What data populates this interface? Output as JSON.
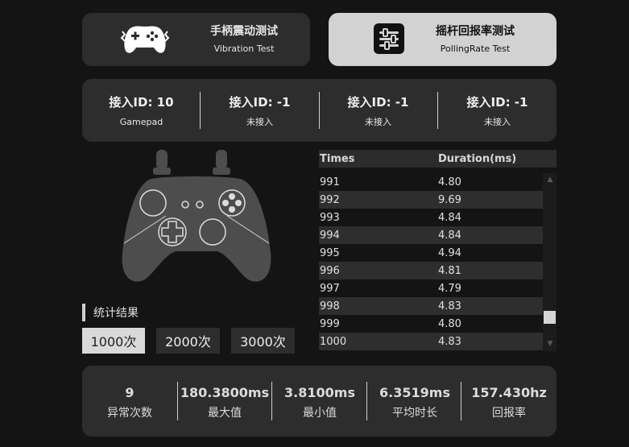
{
  "tabs": {
    "vibration": {
      "title": "手柄震动测试",
      "subtitle": "Vibration Test",
      "icon": "gamepad-vibration-icon"
    },
    "polling": {
      "title": "摇杆回报率测试",
      "subtitle": "PollingRate Test",
      "icon": "sliders-icon",
      "active": true
    }
  },
  "connections": [
    {
      "id": "接入ID: 10",
      "status": "Gamepad"
    },
    {
      "id": "接入ID: -1",
      "status": "未接入"
    },
    {
      "id": "接入ID: -1",
      "status": "未接入"
    },
    {
      "id": "接入ID: -1",
      "status": "未接入"
    }
  ],
  "stats": {
    "label": "统计结果",
    "buttons": [
      "1000次",
      "2000次",
      "3000次"
    ],
    "selected": "1000次"
  },
  "table": {
    "headers": [
      "Times",
      "Duration(ms)"
    ],
    "rows": [
      [
        "991",
        "4.80"
      ],
      [
        "992",
        "9.69"
      ],
      [
        "993",
        "4.84"
      ],
      [
        "994",
        "4.84"
      ],
      [
        "995",
        "4.94"
      ],
      [
        "996",
        "4.81"
      ],
      [
        "997",
        "4.79"
      ],
      [
        "998",
        "4.83"
      ],
      [
        "999",
        "4.80"
      ],
      [
        "1000",
        "4.83"
      ]
    ]
  },
  "summary": [
    {
      "value": "9",
      "label": "异常次数"
    },
    {
      "value": "180.3800ms",
      "label": "最大值"
    },
    {
      "value": "3.8100ms",
      "label": "最小值"
    },
    {
      "value": "6.3519ms",
      "label": "平均时长"
    },
    {
      "value": "157.430hz",
      "label": "回报率"
    }
  ],
  "colors": {
    "panel": "#2d2d2d",
    "background": "#141414",
    "active_tab": "#d2d2d2"
  }
}
